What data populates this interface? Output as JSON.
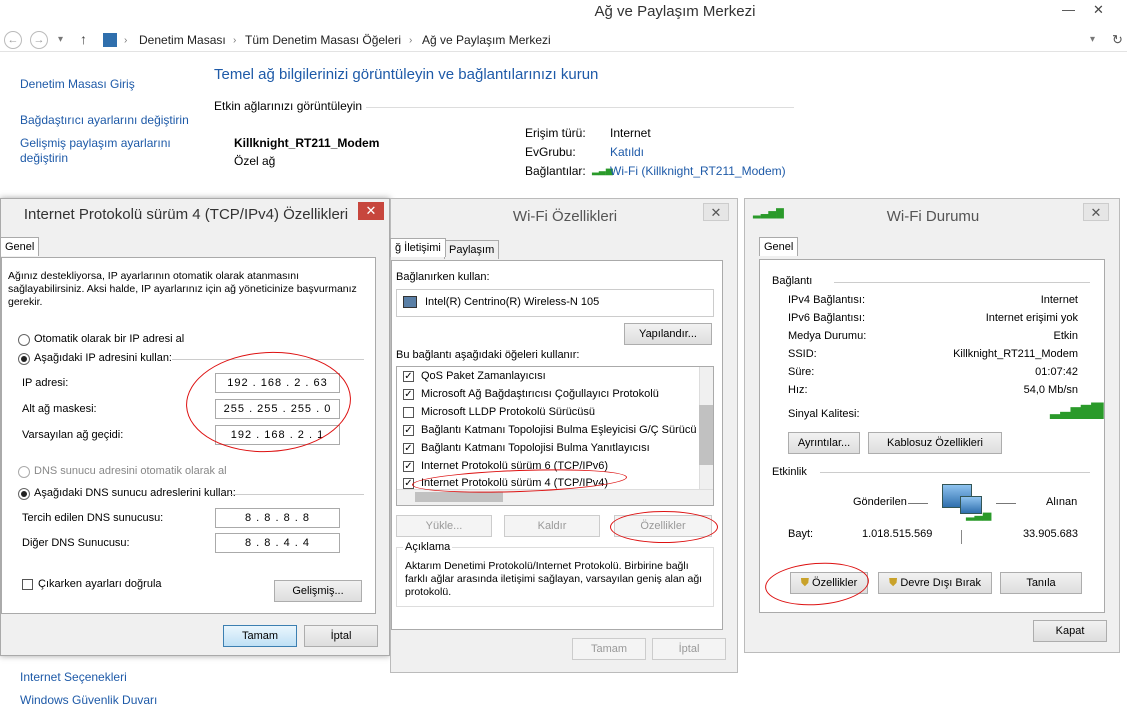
{
  "window": {
    "title": "Ağ ve Paylaşım Merkezi"
  },
  "address": {
    "crumbs": [
      "Denetim Masası",
      "Tüm Denetim Masası Öğeleri",
      "Ağ ve Paylaşım Merkezi"
    ]
  },
  "sidebar": {
    "items": [
      "Denetim Masası Giriş",
      "Bağdaştırıcı ayarlarını değiştirin",
      "Gelişmiş paylaşım ayarlarını değiştirin"
    ],
    "see_also": [
      "Internet Seçenekleri",
      "Windows Güvenlik Duvarı"
    ]
  },
  "main": {
    "heading": "Temel ağ bilgilerinizi görüntüleyin ve bağlantılarınızı kurun",
    "section": "Etkin ağlarınızı görüntüleyin",
    "network_name": "Killknight_RT211_Modem",
    "network_type": "Özel ağ",
    "access_label": "Erişim türü:",
    "access_value": "Internet",
    "homegroup_label": "EvGrubu:",
    "homegroup_value": "Katıldı",
    "connections_label": "Bağlantılar:",
    "connections_value": "Wi-Fi (Killknight_RT211_Modem)"
  },
  "ipv4": {
    "title": "Internet Protokolü sürüm 4 (TCP/IPv4) Özellikleri",
    "tab": "Genel",
    "desc": "Ağınız destekliyorsa, IP ayarlarının otomatik olarak atanmasını sağlayabilirsiniz. Aksi halde, IP ayarlarınız için ağ yöneticinize başvurmanız gerekir.",
    "auto_ip": "Otomatik olarak bir IP adresi al",
    "manual_ip": "Aşağıdaki IP adresini kullan:",
    "ip_label": "IP adresi:",
    "ip": "192 . 168 . 2 . 63",
    "mask_label": "Alt ağ maskesi:",
    "mask": "255 . 255 . 255 . 0",
    "gw_label": "Varsayılan ağ geçidi:",
    "gw": "192 . 168 . 2 . 1",
    "auto_dns": "DNS sunucu adresini otomatik olarak al",
    "manual_dns": "Aşağıdaki DNS sunucu adreslerini kullan:",
    "dns1_label": "Tercih edilen DNS sunucusu:",
    "dns1": "8 . 8 . 8 . 8",
    "dns2_label": "Diğer DNS Sunucusu:",
    "dns2": "8 . 8 . 4 . 4",
    "validate": "Çıkarken ayarları doğrula",
    "advanced": "Gelişmiş...",
    "ok": "Tamam",
    "cancel": "İptal"
  },
  "wifiprops": {
    "title": "Wi-Fi Özellikleri",
    "tab1": "ğ İletişimi",
    "tab2": "Paylaşım",
    "connect_using": "Bağlanırken kullan:",
    "adapter": "Intel(R) Centrino(R) Wireless-N 105",
    "configure": "Yapılandır...",
    "items_label": "Bu bağlantı aşağıdaki öğeleri kullanır:",
    "items": [
      "QoS Paket Zamanlayıcısı",
      "Microsoft Ağ Bağdaştırıcısı Çoğullayıcı Protokolü",
      "Microsoft LLDP Protokolü Sürücüsü",
      "Bağlantı Katmanı Topolojisi Bulma Eşleyicisi G/Ç Sürücü",
      "Bağlantı Katmanı Topolojisi Bulma Yanıtlayıcısı",
      "Internet Protokolü sürüm 6 (TCP/IPv6)",
      "Internet Protokolü sürüm 4 (TCP/IPv4)"
    ],
    "install": "Yükle...",
    "uninstall": "Kaldır",
    "properties": "Özellikler",
    "desc_title": "Açıklama",
    "desc": "Aktarım Denetimi Protokolü/Internet Protokolü. Birbirine bağlı farklı ağlar arasında iletişimi sağlayan, varsayılan geniş alan ağı protokolü.",
    "ok": "Tamam",
    "cancel": "İptal"
  },
  "wifistatus": {
    "title": "Wi-Fi Durumu",
    "tab": "Genel",
    "conn": "Bağlantı",
    "rows": [
      {
        "k": "IPv4 Bağlantısı:",
        "v": "Internet"
      },
      {
        "k": "IPv6 Bağlantısı:",
        "v": "Internet erişimi yok"
      },
      {
        "k": "Medya Durumu:",
        "v": "Etkin"
      },
      {
        "k": "SSID:",
        "v": "Killknight_RT211_Modem"
      },
      {
        "k": "Süre:",
        "v": "01:07:42"
      },
      {
        "k": "Hız:",
        "v": "54,0 Mb/sn"
      }
    ],
    "signal": "Sinyal Kalitesi:",
    "details": "Ayrıntılar...",
    "wireless": "Kablosuz Özellikleri",
    "activity": "Etkinlik",
    "sent": "Gönderilen",
    "received": "Alınan",
    "bytes": "Bayt:",
    "sent_val": "1.018.515.569",
    "recv_val": "33.905.683",
    "properties": "Özellikler",
    "disable": "Devre Dışı Bırak",
    "diagnose": "Tanıla",
    "close": "Kapat"
  }
}
